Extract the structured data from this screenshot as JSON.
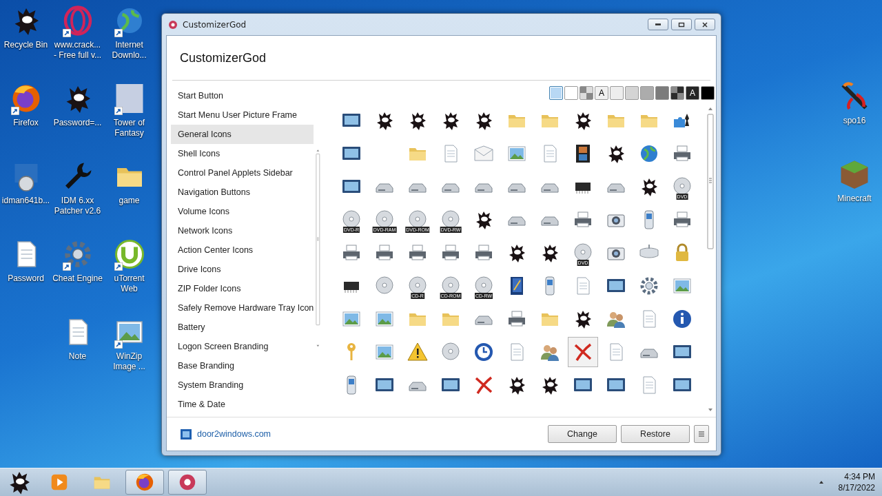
{
  "desktop": {
    "columns": [
      [
        {
          "label": "Recycle Bin",
          "kind": "blob",
          "shortcut": false
        },
        {
          "label": "Firefox",
          "kind": "firefox",
          "shortcut": true
        },
        {
          "label": "idman641b...",
          "kind": "installer",
          "shortcut": false
        },
        {
          "label": "Password",
          "kind": "doc",
          "shortcut": false
        }
      ],
      [
        {
          "label": "www.crack...\n- Free full v...",
          "kind": "ring",
          "shortcut": true
        },
        {
          "label": "Password=...",
          "kind": "blob",
          "shortcut": false
        },
        {
          "label": "IDM 6.xx\nPatcher v2.6",
          "kind": "wrench",
          "shortcut": false
        },
        {
          "label": "Cheat Engine",
          "kind": "gear",
          "shortcut": true
        },
        {
          "label": "Note",
          "kind": "doc",
          "shortcut": false
        }
      ],
      [
        {
          "label": "Internet\nDownlo...",
          "kind": "globe",
          "shortcut": true
        },
        {
          "label": "Tower of\nFantasy",
          "kind": "photo",
          "shortcut": true
        },
        {
          "label": "game",
          "kind": "folder",
          "shortcut": false
        },
        {
          "label": "uTorrent\nWeb",
          "kind": "torrent",
          "shortcut": true
        },
        {
          "label": "WinZip\nImage ...",
          "kind": "picture",
          "shortcut": true
        }
      ]
    ],
    "right_column": [
      {
        "label": "spo16",
        "kind": "sword",
        "shortcut": false
      },
      {
        "label": "Minecraft",
        "kind": "cube",
        "shortcut": false
      }
    ]
  },
  "window": {
    "title": "CustomizerGod",
    "heading": "CustomizerGod",
    "sidebar": {
      "items": [
        {
          "label": "Start Button",
          "selected": false
        },
        {
          "label": "Start Menu User Picture Frame",
          "selected": false
        },
        {
          "label": "General Icons",
          "selected": true
        },
        {
          "label": "Shell Icons",
          "selected": false
        },
        {
          "label": "Control Panel Applets Sidebar",
          "selected": false
        },
        {
          "label": "Navigation Buttons",
          "selected": false
        },
        {
          "label": "Volume Icons",
          "selected": false
        },
        {
          "label": "Network Icons",
          "selected": false
        },
        {
          "label": "Action Center Icons",
          "selected": false
        },
        {
          "label": "Drive Icons",
          "selected": false
        },
        {
          "label": "ZIP Folder Icons",
          "selected": false
        },
        {
          "label": "Safely Remove Hardware Tray Icon",
          "selected": false
        },
        {
          "label": "Battery",
          "selected": false
        },
        {
          "label": "Logon Screen Branding",
          "selected": false
        },
        {
          "label": "Base Branding",
          "selected": false
        },
        {
          "label": "System Branding",
          "selected": false
        },
        {
          "label": "Time & Date",
          "selected": false
        }
      ]
    },
    "swatches": [
      {
        "kind": "plain",
        "color": "#b8d8f4",
        "selected": true
      },
      {
        "kind": "plain",
        "color": "#ffffff",
        "selected": false
      },
      {
        "kind": "checker",
        "color": "#dcdcdc",
        "selected": false
      },
      {
        "kind": "letter",
        "color": "#f0f0f0",
        "label": "A",
        "selected": false
      },
      {
        "kind": "plain",
        "color": "#ededed",
        "selected": false
      },
      {
        "kind": "plain",
        "color": "#d4d4d4",
        "selected": false
      },
      {
        "kind": "plain",
        "color": "#acacac",
        "selected": false
      },
      {
        "kind": "plain",
        "color": "#7c7c7c",
        "selected": false
      },
      {
        "kind": "checker",
        "color": "#2c2c2c",
        "selected": false
      },
      {
        "kind": "letter",
        "color": "#262626",
        "label": "A",
        "selected": false
      },
      {
        "kind": "plain",
        "color": "#000000",
        "selected": false
      }
    ],
    "icon_grid": [
      {
        "cells": [
          {
            "kind": "screen",
            "selected": false
          },
          {
            "kind": "blob",
            "selected": false
          },
          {
            "kind": "blob",
            "selected": false
          },
          {
            "kind": "blob",
            "selected": false
          },
          {
            "kind": "blob",
            "selected": false
          },
          {
            "kind": "folder",
            "selected": false
          },
          {
            "kind": "folder",
            "selected": false
          },
          {
            "kind": "blob",
            "selected": false
          },
          {
            "kind": "folder",
            "selected": false
          },
          {
            "kind": "folder",
            "selected": false
          },
          {
            "kind": "puzzle",
            "selected": false
          }
        ]
      },
      {
        "cells": [
          {
            "kind": "screen",
            "selected": false
          },
          {
            "kind": "blank",
            "selected": false
          },
          {
            "kind": "folder",
            "selected": false
          },
          {
            "kind": "doc",
            "selected": false
          },
          {
            "kind": "envelope",
            "selected": false
          },
          {
            "kind": "picture",
            "selected": false
          },
          {
            "kind": "doc",
            "selected": false
          },
          {
            "kind": "film",
            "selected": false
          },
          {
            "kind": "blob",
            "selected": false
          },
          {
            "kind": "globe",
            "selected": false
          },
          {
            "kind": "printer",
            "selected": false
          }
        ]
      },
      {
        "cells": [
          {
            "kind": "screen",
            "selected": false
          },
          {
            "kind": "drive",
            "selected": false
          },
          {
            "kind": "drive",
            "selected": false
          },
          {
            "kind": "drive",
            "selected": false
          },
          {
            "kind": "drive",
            "selected": false
          },
          {
            "kind": "drive",
            "selected": false
          },
          {
            "kind": "drive",
            "selected": false
          },
          {
            "kind": "chip",
            "selected": false
          },
          {
            "kind": "drive",
            "selected": false
          },
          {
            "kind": "blob",
            "selected": false
          },
          {
            "kind": "disc",
            "label": "DVD",
            "selected": false
          }
        ]
      },
      {
        "cells": [
          {
            "kind": "disc",
            "label": "DVD-R",
            "selected": false
          },
          {
            "kind": "disc",
            "label": "DVD-RAM",
            "selected": false
          },
          {
            "kind": "disc",
            "label": "DVD-ROM",
            "selected": false
          },
          {
            "kind": "disc",
            "label": "DVD-RW",
            "selected": false
          },
          {
            "kind": "blob",
            "selected": false
          },
          {
            "kind": "drive",
            "selected": false
          },
          {
            "kind": "drive",
            "selected": false
          },
          {
            "kind": "printer",
            "selected": false
          },
          {
            "kind": "camera",
            "selected": false
          },
          {
            "kind": "phone",
            "selected": false
          },
          {
            "kind": "printer",
            "selected": false
          }
        ]
      },
      {
        "cells": [
          {
            "kind": "printer",
            "selected": false
          },
          {
            "kind": "printer",
            "selected": false
          },
          {
            "kind": "printer",
            "selected": false
          },
          {
            "kind": "printer",
            "selected": false
          },
          {
            "kind": "printer",
            "selected": false
          },
          {
            "kind": "blob",
            "selected": false
          },
          {
            "kind": "blob",
            "selected": false
          },
          {
            "kind": "disc",
            "label": "DVD",
            "selected": false
          },
          {
            "kind": "camera",
            "selected": false
          },
          {
            "kind": "mouse",
            "selected": false
          },
          {
            "kind": "padlock",
            "selected": false
          }
        ]
      },
      {
        "cells": [
          {
            "kind": "chip",
            "selected": false
          },
          {
            "kind": "disc",
            "selected": false
          },
          {
            "kind": "disc",
            "label": "CD-R",
            "selected": false
          },
          {
            "kind": "disc",
            "label": "CD-ROM",
            "selected": false
          },
          {
            "kind": "disc",
            "label": "CD-RW",
            "selected": false
          },
          {
            "kind": "book",
            "selected": false
          },
          {
            "kind": "phone",
            "selected": false
          },
          {
            "kind": "doc",
            "selected": false
          },
          {
            "kind": "screen",
            "selected": false
          },
          {
            "kind": "gear",
            "selected": false
          },
          {
            "kind": "picture",
            "selected": false
          }
        ]
      },
      {
        "cells": [
          {
            "kind": "picture",
            "selected": false
          },
          {
            "kind": "picture",
            "selected": false
          },
          {
            "kind": "folder",
            "selected": false
          },
          {
            "kind": "folder",
            "selected": false
          },
          {
            "kind": "drive",
            "selected": false
          },
          {
            "kind": "printer",
            "selected": false
          },
          {
            "kind": "folder",
            "selected": false
          },
          {
            "kind": "blob",
            "selected": false
          },
          {
            "kind": "people",
            "selected": false
          },
          {
            "kind": "doc",
            "selected": false
          },
          {
            "kind": "info",
            "selected": false
          }
        ]
      },
      {
        "cells": [
          {
            "kind": "key",
            "selected": false
          },
          {
            "kind": "picture",
            "selected": false
          },
          {
            "kind": "warning",
            "selected": false
          },
          {
            "kind": "disc",
            "selected": false
          },
          {
            "kind": "clock",
            "selected": false
          },
          {
            "kind": "doc",
            "selected": false
          },
          {
            "kind": "people",
            "selected": false
          },
          {
            "kind": "cross",
            "selected": true
          },
          {
            "kind": "doc",
            "selected": false
          },
          {
            "kind": "drive",
            "selected": false
          },
          {
            "kind": "screen",
            "selected": false
          }
        ]
      },
      {
        "cells": [
          {
            "kind": "phone",
            "selected": false
          },
          {
            "kind": "screen",
            "selected": false
          },
          {
            "kind": "drive",
            "selected": false
          },
          {
            "kind": "screen",
            "selected": false
          },
          {
            "kind": "cross",
            "selected": false
          },
          {
            "kind": "blob",
            "selected": false
          },
          {
            "kind": "blob",
            "selected": false
          },
          {
            "kind": "screen",
            "selected": false
          },
          {
            "kind": "screen",
            "selected": false
          },
          {
            "kind": "doc",
            "selected": false
          },
          {
            "kind": "screen",
            "selected": false
          }
        ]
      }
    ],
    "footer": {
      "link": "door2windows.com",
      "buttons": [
        "Change",
        "Restore"
      ]
    }
  },
  "taskbar": {
    "items": [
      {
        "kind": "play",
        "open": false
      },
      {
        "kind": "folder",
        "open": false
      },
      {
        "kind": "firefox",
        "open": true
      },
      {
        "kind": "cog",
        "open": true
      }
    ],
    "time": "4:34 PM",
    "date": "8/17/2022"
  }
}
